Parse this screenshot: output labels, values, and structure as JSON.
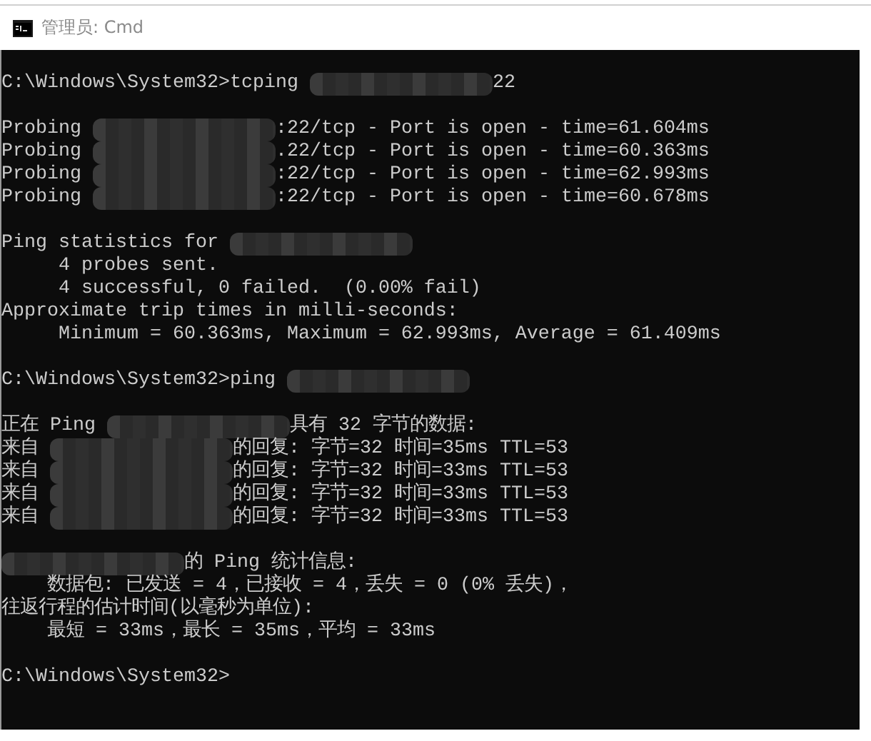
{
  "window": {
    "title": "管理员: Cmd"
  },
  "console": {
    "lines": [
      {
        "kind": "blank"
      },
      {
        "kind": "output",
        "segments": [
          {
            "kind": "text",
            "text": "C:\\Windows\\System32>tcping "
          },
          {
            "kind": "mask"
          },
          {
            "kind": "text",
            "text": "22"
          }
        ]
      },
      {
        "kind": "blank"
      },
      {
        "kind": "output",
        "segments": [
          {
            "kind": "text",
            "text": "Probing "
          },
          {
            "kind": "mask"
          },
          {
            "kind": "text",
            "text": ":22/tcp - Port is open - time=61.604ms"
          }
        ]
      },
      {
        "kind": "output",
        "segments": [
          {
            "kind": "text",
            "text": "Probing "
          },
          {
            "kind": "mask"
          },
          {
            "kind": "text",
            "text": ".22/tcp - Port is open - time=60.363ms"
          }
        ]
      },
      {
        "kind": "output",
        "segments": [
          {
            "kind": "text",
            "text": "Probing "
          },
          {
            "kind": "mask"
          },
          {
            "kind": "text",
            "text": ":22/tcp - Port is open - time=62.993ms"
          }
        ]
      },
      {
        "kind": "output",
        "segments": [
          {
            "kind": "text",
            "text": "Probing "
          },
          {
            "kind": "mask"
          },
          {
            "kind": "text",
            "text": ":22/tcp - Port is open - time=60.678ms"
          }
        ]
      },
      {
        "kind": "blank"
      },
      {
        "kind": "output",
        "segments": [
          {
            "kind": "text",
            "text": "Ping statistics for "
          },
          {
            "kind": "mask"
          }
        ]
      },
      {
        "kind": "output",
        "segments": [
          {
            "kind": "text",
            "text": "     4 probes sent."
          }
        ]
      },
      {
        "kind": "output",
        "segments": [
          {
            "kind": "text",
            "text": "     4 successful, 0 failed.  (0.00% fail)"
          }
        ]
      },
      {
        "kind": "output",
        "segments": [
          {
            "kind": "text",
            "text": "Approximate trip times in milli-seconds:"
          }
        ]
      },
      {
        "kind": "output",
        "segments": [
          {
            "kind": "text",
            "text": "     Minimum = 60.363ms, Maximum = 62.993ms, Average = 61.409ms"
          }
        ]
      },
      {
        "kind": "blank"
      },
      {
        "kind": "output",
        "segments": [
          {
            "kind": "text",
            "text": "C:\\Windows\\System32>ping "
          },
          {
            "kind": "mask"
          }
        ]
      },
      {
        "kind": "blank"
      },
      {
        "kind": "output",
        "segments": [
          {
            "kind": "text",
            "text": "正在 Ping "
          },
          {
            "kind": "mask"
          },
          {
            "kind": "text",
            "text": "具有 32 字节的数据:"
          }
        ]
      },
      {
        "kind": "output",
        "segments": [
          {
            "kind": "text",
            "text": "来自 "
          },
          {
            "kind": "mask"
          },
          {
            "kind": "text",
            "text": "的回复: 字节=32 时间=35ms TTL=53"
          }
        ]
      },
      {
        "kind": "output",
        "segments": [
          {
            "kind": "text",
            "text": "来自 "
          },
          {
            "kind": "mask"
          },
          {
            "kind": "text",
            "text": "的回复: 字节=32 时间=33ms TTL=53"
          }
        ]
      },
      {
        "kind": "output",
        "segments": [
          {
            "kind": "text",
            "text": "来自 "
          },
          {
            "kind": "mask"
          },
          {
            "kind": "text",
            "text": "的回复: 字节=32 时间=33ms TTL=53"
          }
        ]
      },
      {
        "kind": "output",
        "segments": [
          {
            "kind": "text",
            "text": "来自 "
          },
          {
            "kind": "mask"
          },
          {
            "kind": "text",
            "text": "的回复: 字节=32 时间=33ms TTL=53"
          }
        ]
      },
      {
        "kind": "blank"
      },
      {
        "kind": "output",
        "segments": [
          {
            "kind": "mask"
          },
          {
            "kind": "text",
            "text": "的 Ping 统计信息:"
          }
        ]
      },
      {
        "kind": "output",
        "segments": [
          {
            "kind": "text",
            "text": "    数据包: 已发送 = 4，已接收 = 4，丢失 = 0 (0% 丢失)，"
          }
        ]
      },
      {
        "kind": "output",
        "segments": [
          {
            "kind": "text",
            "text": "往返行程的估计时间(以毫秒为单位):"
          }
        ]
      },
      {
        "kind": "output",
        "segments": [
          {
            "kind": "text",
            "text": "    最短 = 33ms，最长 = 35ms，平均 = 33ms"
          }
        ]
      },
      {
        "kind": "blank"
      },
      {
        "kind": "output",
        "segments": [
          {
            "kind": "text",
            "text": "C:\\Windows\\System32>"
          }
        ]
      }
    ]
  }
}
